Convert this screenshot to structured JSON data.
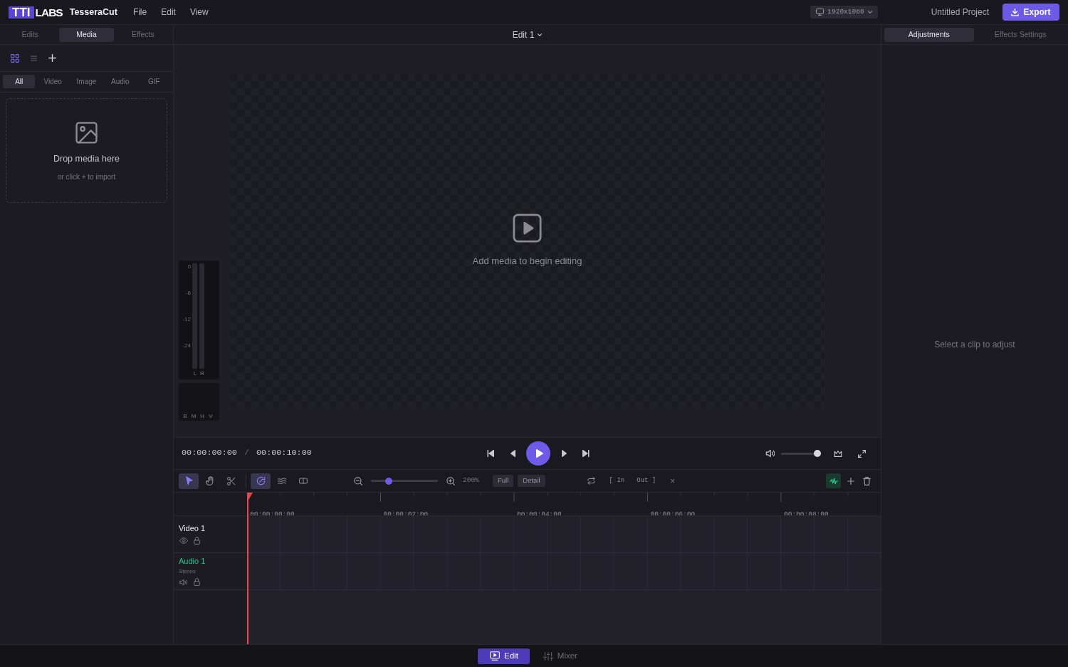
{
  "app": {
    "logo_mark": "TTI",
    "logo_text": "LABS",
    "name": "TesseraCut"
  },
  "menu": [
    "File",
    "Edit",
    "View"
  ],
  "resolution": "1920x1080",
  "project_title": "Untitled Project",
  "export_button": "Export",
  "left_panel": {
    "tabs": [
      {
        "label": "Edits",
        "selected": false
      },
      {
        "label": "Media",
        "selected": true
      },
      {
        "label": "Effects",
        "selected": false
      }
    ],
    "view_toggles": [
      {
        "kind": "grid",
        "selected": true
      },
      {
        "kind": "list",
        "selected": false
      }
    ],
    "filters": [
      {
        "label": "All",
        "selected": true
      },
      {
        "label": "Video",
        "selected": false
      },
      {
        "label": "Image",
        "selected": false
      },
      {
        "label": "Audio",
        "selected": false
      },
      {
        "label": "GIF",
        "selected": false
      }
    ],
    "drop_zone": {
      "title": "Drop media here",
      "hint": "or click + to import"
    }
  },
  "viewer": {
    "sequence": "Edit 1",
    "empty_message": "Add media to begin editing",
    "level_meter": {
      "scale": [
        "0",
        "-6",
        "-12",
        "-24"
      ],
      "channels": [
        "L",
        "R"
      ]
    },
    "scope_labels": [
      "B",
      "M",
      "H",
      "V"
    ]
  },
  "transport": {
    "current_time": "00:00:00:00",
    "separator": "/",
    "duration": "00:00:10:00",
    "volume": {
      "level": 1.0
    }
  },
  "timeline_toolbar": {
    "tools": [
      {
        "kind": "select",
        "selected": true
      },
      {
        "kind": "hand",
        "selected": false
      },
      {
        "kind": "cut",
        "selected": false
      }
    ],
    "toggles": [
      {
        "kind": "rotate",
        "on": true
      },
      {
        "kind": "waves",
        "on": false
      },
      {
        "kind": "columns",
        "on": false
      }
    ],
    "zoom": {
      "level": 0.24,
      "reading": "200%"
    },
    "view_buttons": [
      "Full",
      "Detail"
    ],
    "in_label": "[ In",
    "out_label": "Out ]",
    "clear": "×",
    "waveforms": {
      "on": true
    }
  },
  "ruler": [
    "00:00:00:00",
    "00:00:02:00",
    "00:00:04:00",
    "00:00:06:00",
    "00:00:08:00"
  ],
  "tracks": [
    {
      "kind": "video",
      "name": "Video 1"
    },
    {
      "kind": "audio",
      "name": "Audio 1",
      "subtitle": "Stereo"
    }
  ],
  "right_panel": {
    "tabs": [
      {
        "label": "Adjustments",
        "selected": true
      },
      {
        "label": "Effects Settings",
        "selected": false
      }
    ],
    "empty_message": "Select a clip to adjust"
  },
  "workspaces": [
    {
      "kind": "edit",
      "label": "Edit",
      "selected": true
    },
    {
      "kind": "mixer",
      "label": "Mixer",
      "selected": false
    }
  ]
}
